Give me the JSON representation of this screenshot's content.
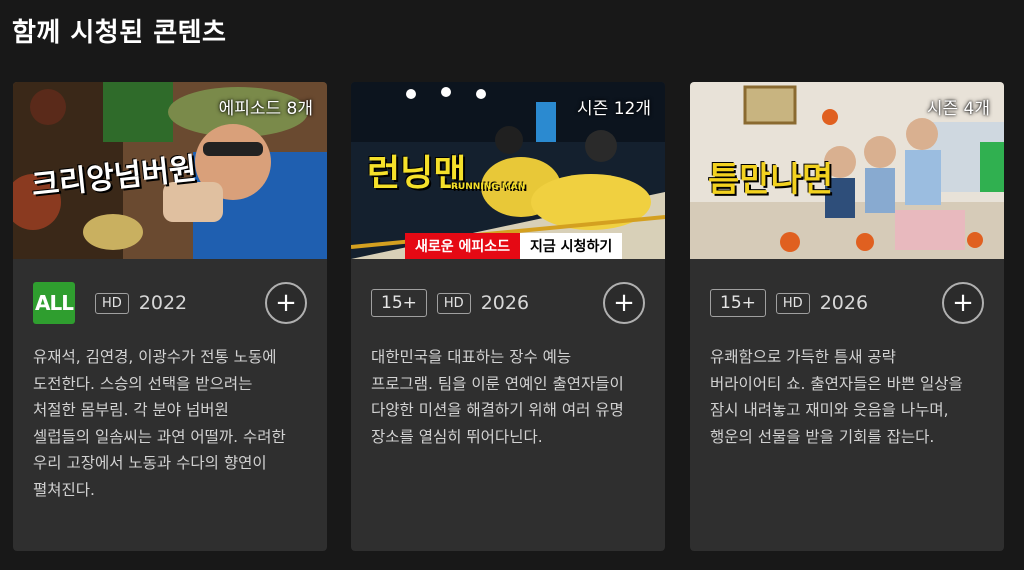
{
  "section": {
    "title": "함께 시청된 콘텐츠"
  },
  "cards": [
    {
      "badge": "에피소드 8개",
      "logo": "크리앙넘버원",
      "rating": "ALL",
      "hd": "HD",
      "year": "2022",
      "add": "+",
      "description": "유재석, 김연경, 이광수가 전통 노동에 도전한다. 스승의 선택을 받으려는 처절한 몸부림. 각 분야 넘버원 셀럽들의 일솜씨는 과연 어떨까. 수려한 우리 고장에서 노동과 수다의 향연이 펼쳐진다."
    },
    {
      "badge": "시즌 12개",
      "logo": "런닝맨",
      "logo_sub": "RUNNING MAN",
      "strip_new": "새로운 에피소드",
      "strip_watch": "지금 시청하기",
      "rating": "15+",
      "hd": "HD",
      "year": "2026",
      "add": "+",
      "description": "대한민국을 대표하는 장수 예능 프로그램. 팀을 이룬 연예인 출연자들이 다양한 미션을 해결하기 위해 여러 유명 장소를 열심히 뛰어다닌다."
    },
    {
      "badge": "시즌 4개",
      "logo": "틈만나면",
      "rating": "15+",
      "hd": "HD",
      "year": "2026",
      "add": "+",
      "description": "유쾌함으로 가득한 틈새 공략 버라이어티 쇼. 출연자들은 바쁜 일상을 잠시 내려놓고 재미와 웃음을 나누며, 행운의 선물을 받을 기회를 잡는다."
    }
  ]
}
